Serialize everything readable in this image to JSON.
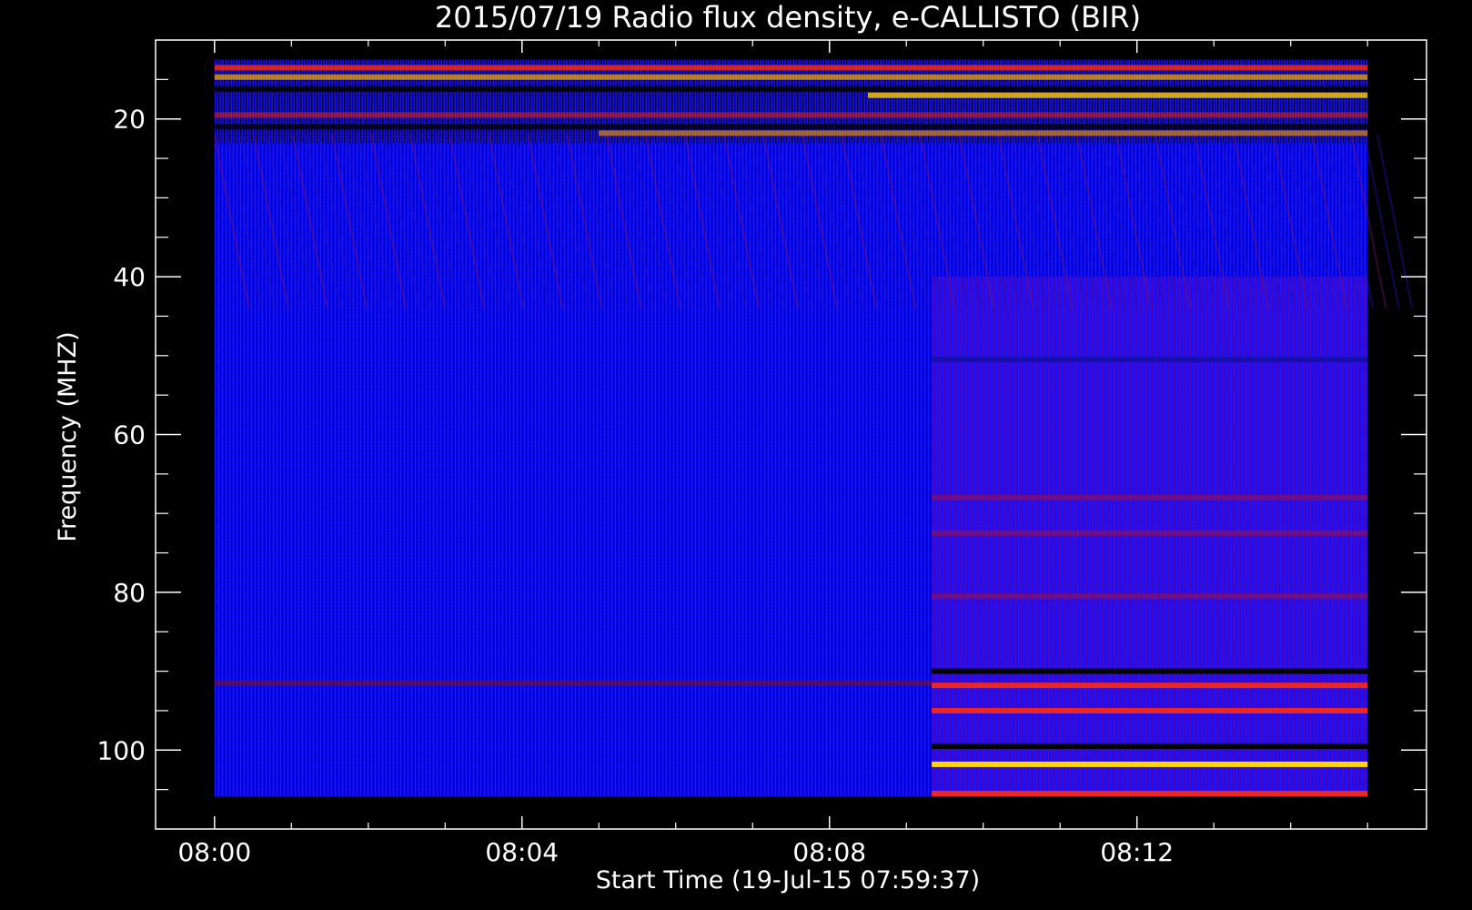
{
  "chart_data": {
    "type": "heatmap",
    "title": "2015/07/19  Radio flux density, e-CALLISTO (BIR)",
    "xlabel": "Start Time (19-Jul-15 07:59:37)",
    "ylabel": "Frequency (MHZ)",
    "x_ticks": [
      "08:00",
      "08:04",
      "08:08",
      "08:12"
    ],
    "x_tick_minutes": [
      0,
      4,
      8,
      12
    ],
    "x_range_minutes": [
      -0.767,
      15.767
    ],
    "x_data_range_minutes": [
      0,
      15
    ],
    "y_ticks": [
      20,
      40,
      60,
      80,
      100
    ],
    "y_range_mhz": [
      10,
      110
    ],
    "y_data_range_mhz": [
      12.5,
      105.9
    ],
    "y_inverted": true,
    "colormap": [
      "#000000",
      "#1010ff",
      "#ff1010",
      "#ffd800",
      "#ffffff"
    ],
    "background_color": "#0000f2",
    "regime_change_minute": 9.33,
    "bands": [
      {
        "freq": 13.5,
        "start": 0,
        "end": 15,
        "color": "#ff2a10",
        "intensity": 0.8
      },
      {
        "freq": 14.7,
        "start": 0,
        "end": 15,
        "color": "#ffb000",
        "intensity": 0.7
      },
      {
        "freq": 16.2,
        "start": 0,
        "end": 15,
        "color": "#000000",
        "intensity": 0.9
      },
      {
        "freq": 17.0,
        "start": 8.5,
        "end": 15,
        "color": "#ffd000",
        "intensity": 0.8
      },
      {
        "freq": 19.5,
        "start": 0,
        "end": 15,
        "color": "#ff2a10",
        "intensity": 0.5
      },
      {
        "freq": 21.0,
        "start": 0,
        "end": 15,
        "color": "#000000",
        "intensity": 0.8
      },
      {
        "freq": 21.8,
        "start": 5,
        "end": 15,
        "color": "#ffa000",
        "intensity": 0.6
      },
      {
        "freq": 91.5,
        "start": 0,
        "end": 9.33,
        "color": "#6a1040",
        "intensity": 0.7
      },
      {
        "freq": 90.0,
        "start": 9.33,
        "end": 15,
        "color": "#000000",
        "intensity": 1.0
      },
      {
        "freq": 91.8,
        "start": 9.33,
        "end": 15,
        "color": "#ff2a10",
        "intensity": 0.9
      },
      {
        "freq": 95.0,
        "start": 9.33,
        "end": 15,
        "color": "#ff2a10",
        "intensity": 0.9
      },
      {
        "freq": 68.0,
        "start": 9.33,
        "end": 15,
        "color": "#8a1060",
        "intensity": 0.7
      },
      {
        "freq": 72.5,
        "start": 9.33,
        "end": 15,
        "color": "#8a1060",
        "intensity": 0.7
      },
      {
        "freq": 80.5,
        "start": 9.33,
        "end": 15,
        "color": "#8a1060",
        "intensity": 0.7
      },
      {
        "freq": 50.5,
        "start": 9.33,
        "end": 15,
        "color": "#1010a0",
        "intensity": 0.8
      },
      {
        "freq": 99.5,
        "start": 9.33,
        "end": 15,
        "color": "#000000",
        "intensity": 1.0
      },
      {
        "freq": 101.8,
        "start": 9.33,
        "end": 15,
        "color": "#ffd800",
        "intensity": 1.0
      },
      {
        "freq": 105.5,
        "start": 9.33,
        "end": 15,
        "color": "#ff2a10",
        "intensity": 0.9
      }
    ]
  }
}
